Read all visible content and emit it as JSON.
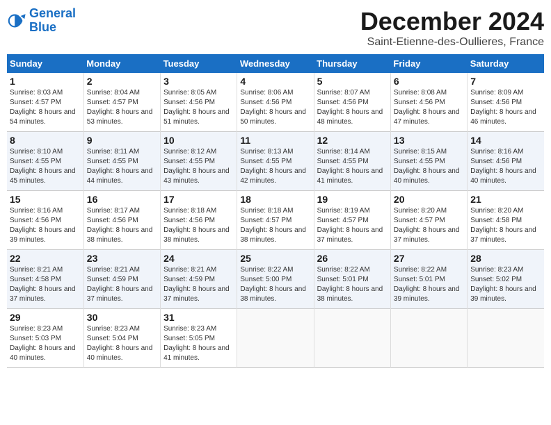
{
  "logo": {
    "line1": "General",
    "line2": "Blue"
  },
  "title": "December 2024",
  "location": "Saint-Etienne-des-Oullieres, France",
  "headers": [
    "Sunday",
    "Monday",
    "Tuesday",
    "Wednesday",
    "Thursday",
    "Friday",
    "Saturday"
  ],
  "weeks": [
    [
      {
        "day": "1",
        "sunrise": "8:03 AM",
        "sunset": "4:57 PM",
        "daylight": "8 hours and 54 minutes."
      },
      {
        "day": "2",
        "sunrise": "8:04 AM",
        "sunset": "4:57 PM",
        "daylight": "8 hours and 53 minutes."
      },
      {
        "day": "3",
        "sunrise": "8:05 AM",
        "sunset": "4:56 PM",
        "daylight": "8 hours and 51 minutes."
      },
      {
        "day": "4",
        "sunrise": "8:06 AM",
        "sunset": "4:56 PM",
        "daylight": "8 hours and 50 minutes."
      },
      {
        "day": "5",
        "sunrise": "8:07 AM",
        "sunset": "4:56 PM",
        "daylight": "8 hours and 48 minutes."
      },
      {
        "day": "6",
        "sunrise": "8:08 AM",
        "sunset": "4:56 PM",
        "daylight": "8 hours and 47 minutes."
      },
      {
        "day": "7",
        "sunrise": "8:09 AM",
        "sunset": "4:56 PM",
        "daylight": "8 hours and 46 minutes."
      }
    ],
    [
      {
        "day": "8",
        "sunrise": "8:10 AM",
        "sunset": "4:55 PM",
        "daylight": "8 hours and 45 minutes."
      },
      {
        "day": "9",
        "sunrise": "8:11 AM",
        "sunset": "4:55 PM",
        "daylight": "8 hours and 44 minutes."
      },
      {
        "day": "10",
        "sunrise": "8:12 AM",
        "sunset": "4:55 PM",
        "daylight": "8 hours and 43 minutes."
      },
      {
        "day": "11",
        "sunrise": "8:13 AM",
        "sunset": "4:55 PM",
        "daylight": "8 hours and 42 minutes."
      },
      {
        "day": "12",
        "sunrise": "8:14 AM",
        "sunset": "4:55 PM",
        "daylight": "8 hours and 41 minutes."
      },
      {
        "day": "13",
        "sunrise": "8:15 AM",
        "sunset": "4:55 PM",
        "daylight": "8 hours and 40 minutes."
      },
      {
        "day": "14",
        "sunrise": "8:16 AM",
        "sunset": "4:56 PM",
        "daylight": "8 hours and 40 minutes."
      }
    ],
    [
      {
        "day": "15",
        "sunrise": "8:16 AM",
        "sunset": "4:56 PM",
        "daylight": "8 hours and 39 minutes."
      },
      {
        "day": "16",
        "sunrise": "8:17 AM",
        "sunset": "4:56 PM",
        "daylight": "8 hours and 38 minutes."
      },
      {
        "day": "17",
        "sunrise": "8:18 AM",
        "sunset": "4:56 PM",
        "daylight": "8 hours and 38 minutes."
      },
      {
        "day": "18",
        "sunrise": "8:18 AM",
        "sunset": "4:57 PM",
        "daylight": "8 hours and 38 minutes."
      },
      {
        "day": "19",
        "sunrise": "8:19 AM",
        "sunset": "4:57 PM",
        "daylight": "8 hours and 37 minutes."
      },
      {
        "day": "20",
        "sunrise": "8:20 AM",
        "sunset": "4:57 PM",
        "daylight": "8 hours and 37 minutes."
      },
      {
        "day": "21",
        "sunrise": "8:20 AM",
        "sunset": "4:58 PM",
        "daylight": "8 hours and 37 minutes."
      }
    ],
    [
      {
        "day": "22",
        "sunrise": "8:21 AM",
        "sunset": "4:58 PM",
        "daylight": "8 hours and 37 minutes."
      },
      {
        "day": "23",
        "sunrise": "8:21 AM",
        "sunset": "4:59 PM",
        "daylight": "8 hours and 37 minutes."
      },
      {
        "day": "24",
        "sunrise": "8:21 AM",
        "sunset": "4:59 PM",
        "daylight": "8 hours and 37 minutes."
      },
      {
        "day": "25",
        "sunrise": "8:22 AM",
        "sunset": "5:00 PM",
        "daylight": "8 hours and 38 minutes."
      },
      {
        "day": "26",
        "sunrise": "8:22 AM",
        "sunset": "5:01 PM",
        "daylight": "8 hours and 38 minutes."
      },
      {
        "day": "27",
        "sunrise": "8:22 AM",
        "sunset": "5:01 PM",
        "daylight": "8 hours and 39 minutes."
      },
      {
        "day": "28",
        "sunrise": "8:23 AM",
        "sunset": "5:02 PM",
        "daylight": "8 hours and 39 minutes."
      }
    ],
    [
      {
        "day": "29",
        "sunrise": "8:23 AM",
        "sunset": "5:03 PM",
        "daylight": "8 hours and 40 minutes."
      },
      {
        "day": "30",
        "sunrise": "8:23 AM",
        "sunset": "5:04 PM",
        "daylight": "8 hours and 40 minutes."
      },
      {
        "day": "31",
        "sunrise": "8:23 AM",
        "sunset": "5:05 PM",
        "daylight": "8 hours and 41 minutes."
      },
      null,
      null,
      null,
      null
    ]
  ]
}
